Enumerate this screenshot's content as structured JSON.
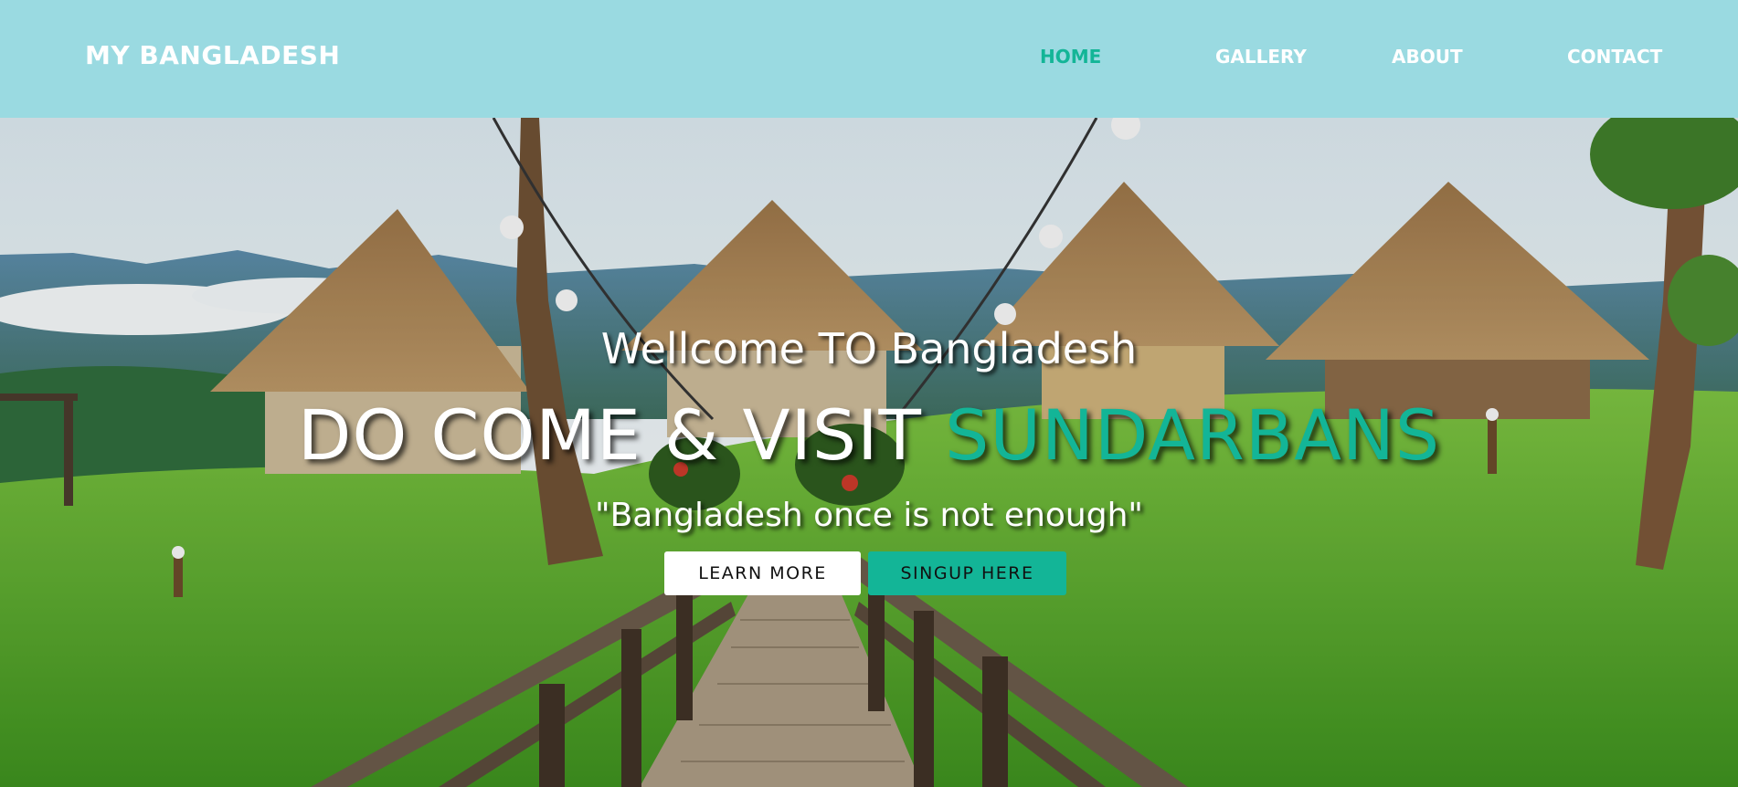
{
  "colors": {
    "navbar_bg": "#9adae1",
    "accent": "#13b597",
    "nav_text": "#ffffff",
    "button_light": "#ffffff"
  },
  "header": {
    "logo": "MY BANGLADESH",
    "nav": [
      {
        "label": "HOME",
        "active": true
      },
      {
        "label": "GALLERY",
        "active": false
      },
      {
        "label": "ABOUT",
        "active": false
      },
      {
        "label": "CONTACT",
        "active": false
      }
    ]
  },
  "hero": {
    "welcome": "Wellcome TO Bangladesh",
    "headline_main": "DO COME & VISIT",
    "headline_accent": "SUNDARBANS",
    "tagline": "\"Bangladesh once is not enough\"",
    "buttons": {
      "learn_more": "LEARN MORE",
      "signup": "SINGUP HERE"
    }
  }
}
